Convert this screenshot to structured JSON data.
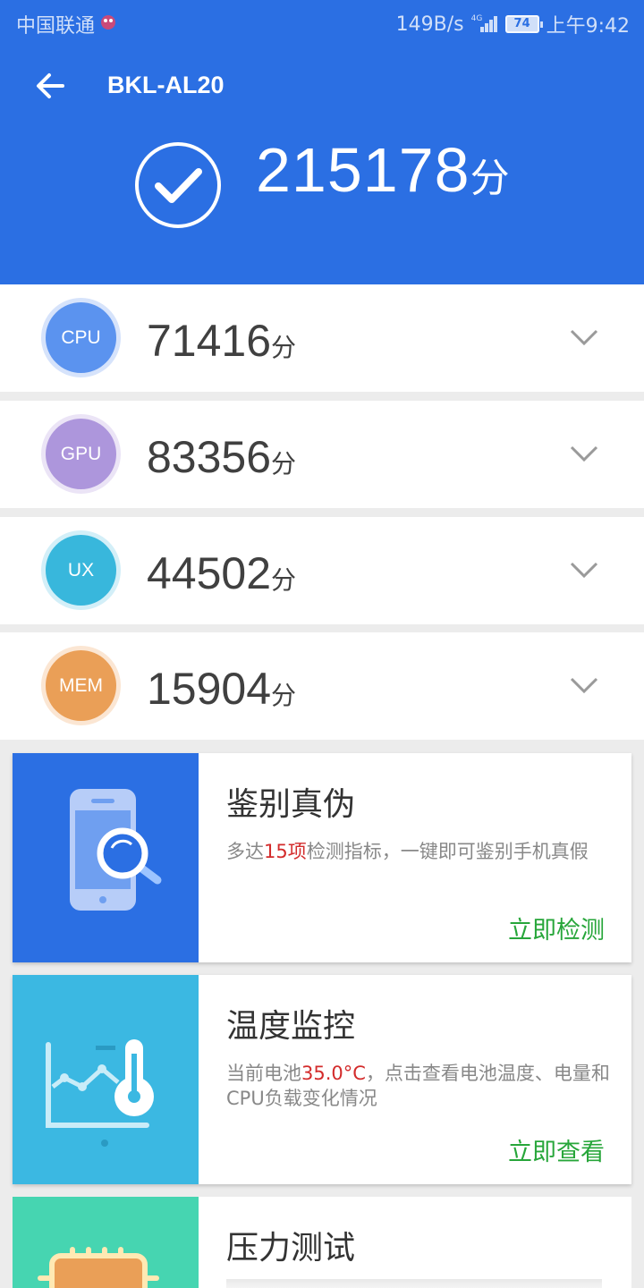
{
  "status_bar": {
    "carrier": "中国联通",
    "net_speed": "149B/s",
    "network": "4G",
    "battery": "74",
    "time": "上午9:42"
  },
  "header": {
    "device_name": "BKL-AL20",
    "total_score": "215178",
    "score_unit": "分",
    "color": "#2b6fe3"
  },
  "scores": [
    {
      "label": "CPU",
      "value": "71416",
      "unit": "分",
      "color": "#5b93ef"
    },
    {
      "label": "GPU",
      "value": "83356",
      "unit": "分",
      "color": "#ad96dc"
    },
    {
      "label": "UX",
      "value": "44502",
      "unit": "分",
      "color": "#38b7dc"
    },
    {
      "label": "MEM",
      "value": "15904",
      "unit": "分",
      "color": "#ea9f57"
    }
  ],
  "cards": [
    {
      "title": "鉴别真伪",
      "desc_pre": "多达",
      "desc_highlight": "15项",
      "desc_post": "检测指标，一键即可鉴别手机真假",
      "action": "立即检测",
      "color": "#2b6fe3"
    },
    {
      "title": "温度监控",
      "desc_pre": "当前电池",
      "desc_highlight": "35.0°C",
      "desc_post": "，点击查看电池温度、电量和CPU负载变化情况",
      "action": "立即查看",
      "color": "#3bb8e2"
    },
    {
      "title": "压力测试",
      "desc_pre": "",
      "desc_highlight": "",
      "desc_post": "",
      "action": "",
      "color": "#46d5b1"
    }
  ]
}
